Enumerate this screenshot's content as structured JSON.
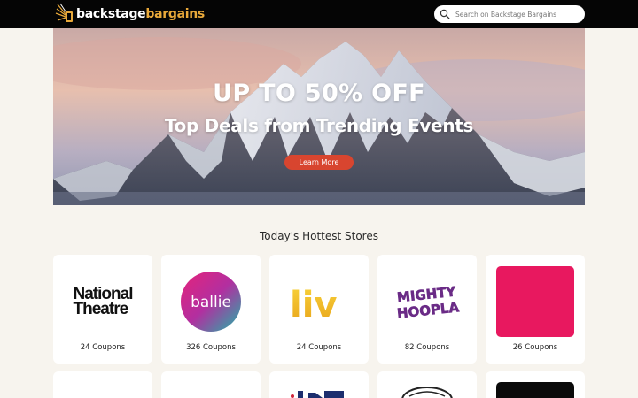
{
  "header": {
    "logo_word1": "backstage",
    "logo_word2": "bargains",
    "search_placeholder": "Search on Backstage Bargains"
  },
  "hero": {
    "headline": "UP TO 50% OFF",
    "subheadline": "Top Deals from Trending Events",
    "cta_label": "Learn More"
  },
  "section": {
    "title": "Today's Hottest Stores"
  },
  "stores": [
    {
      "name_line1": "National",
      "name_line2": "Theatre",
      "coupons": "24 Coupons"
    },
    {
      "name": "ballie",
      "coupons": "326 Coupons"
    },
    {
      "name": "liv",
      "coupons": "24 Coupons"
    },
    {
      "name_line1": "MIGHTY",
      "name_line2": "HOOPLA",
      "coupons": "82 Coupons"
    },
    {
      "coupons": "26 Coupons"
    }
  ],
  "colors": {
    "header_bg": "#050505",
    "accent_gold": "#e9a93a",
    "cta_red": "#d8452f",
    "page_bg": "#f7f4ee",
    "pink_tile": "#e8185f"
  },
  "icons": {
    "search": "search-icon",
    "logo": "spotlight-logo-icon"
  }
}
